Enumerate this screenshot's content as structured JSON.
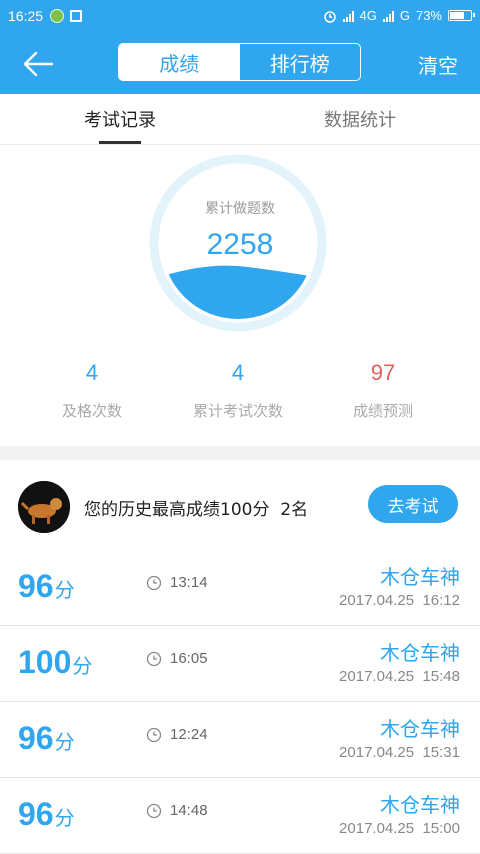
{
  "status_bar": {
    "time": "16:25",
    "network_4g": "4G",
    "network_g": "G",
    "battery_text": "73%",
    "battery_level": 0.73
  },
  "nav": {
    "tabs": [
      "成绩",
      "排行榜"
    ],
    "active_tab": "成绩",
    "clear_label": "清空"
  },
  "subtabs": {
    "items": [
      "考试记录",
      "数据统计"
    ],
    "active": "考试记录"
  },
  "gauge": {
    "label": "累计做题数",
    "value": "2258"
  },
  "stats": [
    {
      "value": "4",
      "label": "及格次数"
    },
    {
      "value": "4",
      "label": "累计考试次数"
    },
    {
      "value": "97",
      "label": "成绩预测"
    }
  ],
  "summary": {
    "text": "您的历史最高成绩100分  2名",
    "exam_button": "去考试"
  },
  "records": [
    {
      "score": "96",
      "unit": "分",
      "duration": "13:14",
      "name": "木仓车神",
      "date": "2017.04.25  16:12"
    },
    {
      "score": "100",
      "unit": "分",
      "duration": "16:05",
      "name": "木仓车神",
      "date": "2017.04.25  15:48"
    },
    {
      "score": "96",
      "unit": "分",
      "duration": "12:24",
      "name": "木仓车神",
      "date": "2017.04.25  15:31"
    },
    {
      "score": "96",
      "unit": "分",
      "duration": "14:48",
      "name": "木仓车神",
      "date": "2017.04.25  15:00"
    }
  ],
  "colors": {
    "accent": "#2fa6ee",
    "prediction": "#e26060"
  }
}
